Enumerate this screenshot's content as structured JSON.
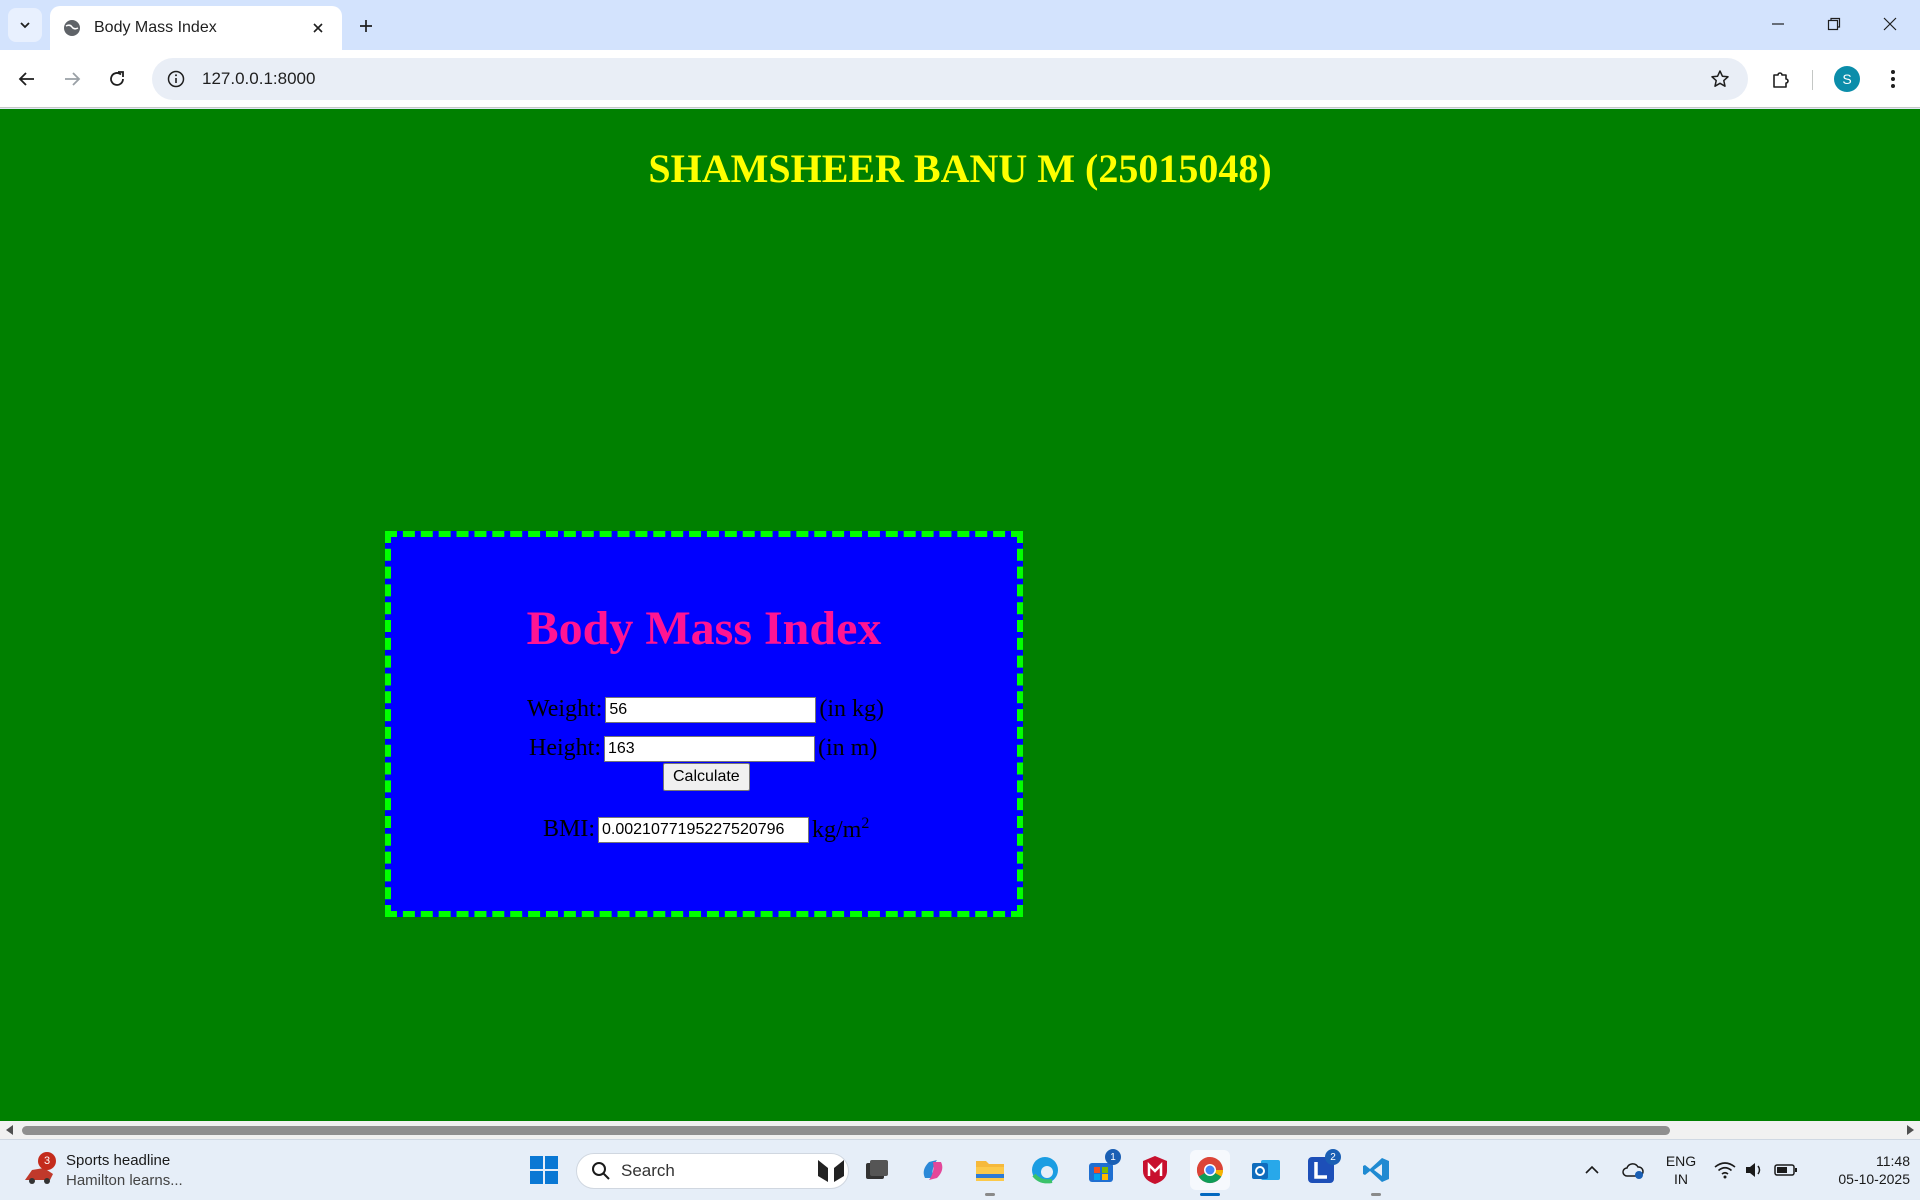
{
  "browser": {
    "tab_title": "Body Mass Index",
    "url": "127.0.0.1:8000",
    "profile_initial": "S"
  },
  "page": {
    "heading": "SHAMSHEER BANU M (25015048)",
    "form": {
      "title": "Body Mass Index",
      "weight_label": "Weight:",
      "weight_value": "56",
      "weight_unit": "(in kg)",
      "height_label": "Height:",
      "height_value": "163",
      "height_unit": "(in m)",
      "calculate_label": "Calculate",
      "bmi_label": "BMI:",
      "bmi_value": "0.0021077195227520796",
      "bmi_unit": "kg/m",
      "bmi_unit_exp": "2"
    },
    "colors": {
      "background": "#008000",
      "heading": "#ffff00",
      "box": "#0000ff",
      "box_border": "#00ff00",
      "title": "#ff1493"
    }
  },
  "taskbar": {
    "news_badge": "3",
    "news_title": "Sports headline",
    "news_subtitle": "Hamilton learns...",
    "search_placeholder": "Search",
    "store_badge": "1",
    "l_app_badge": "2",
    "language_top": "ENG",
    "language_bottom": "IN",
    "time": "11:48",
    "date": "05-10-2025"
  }
}
